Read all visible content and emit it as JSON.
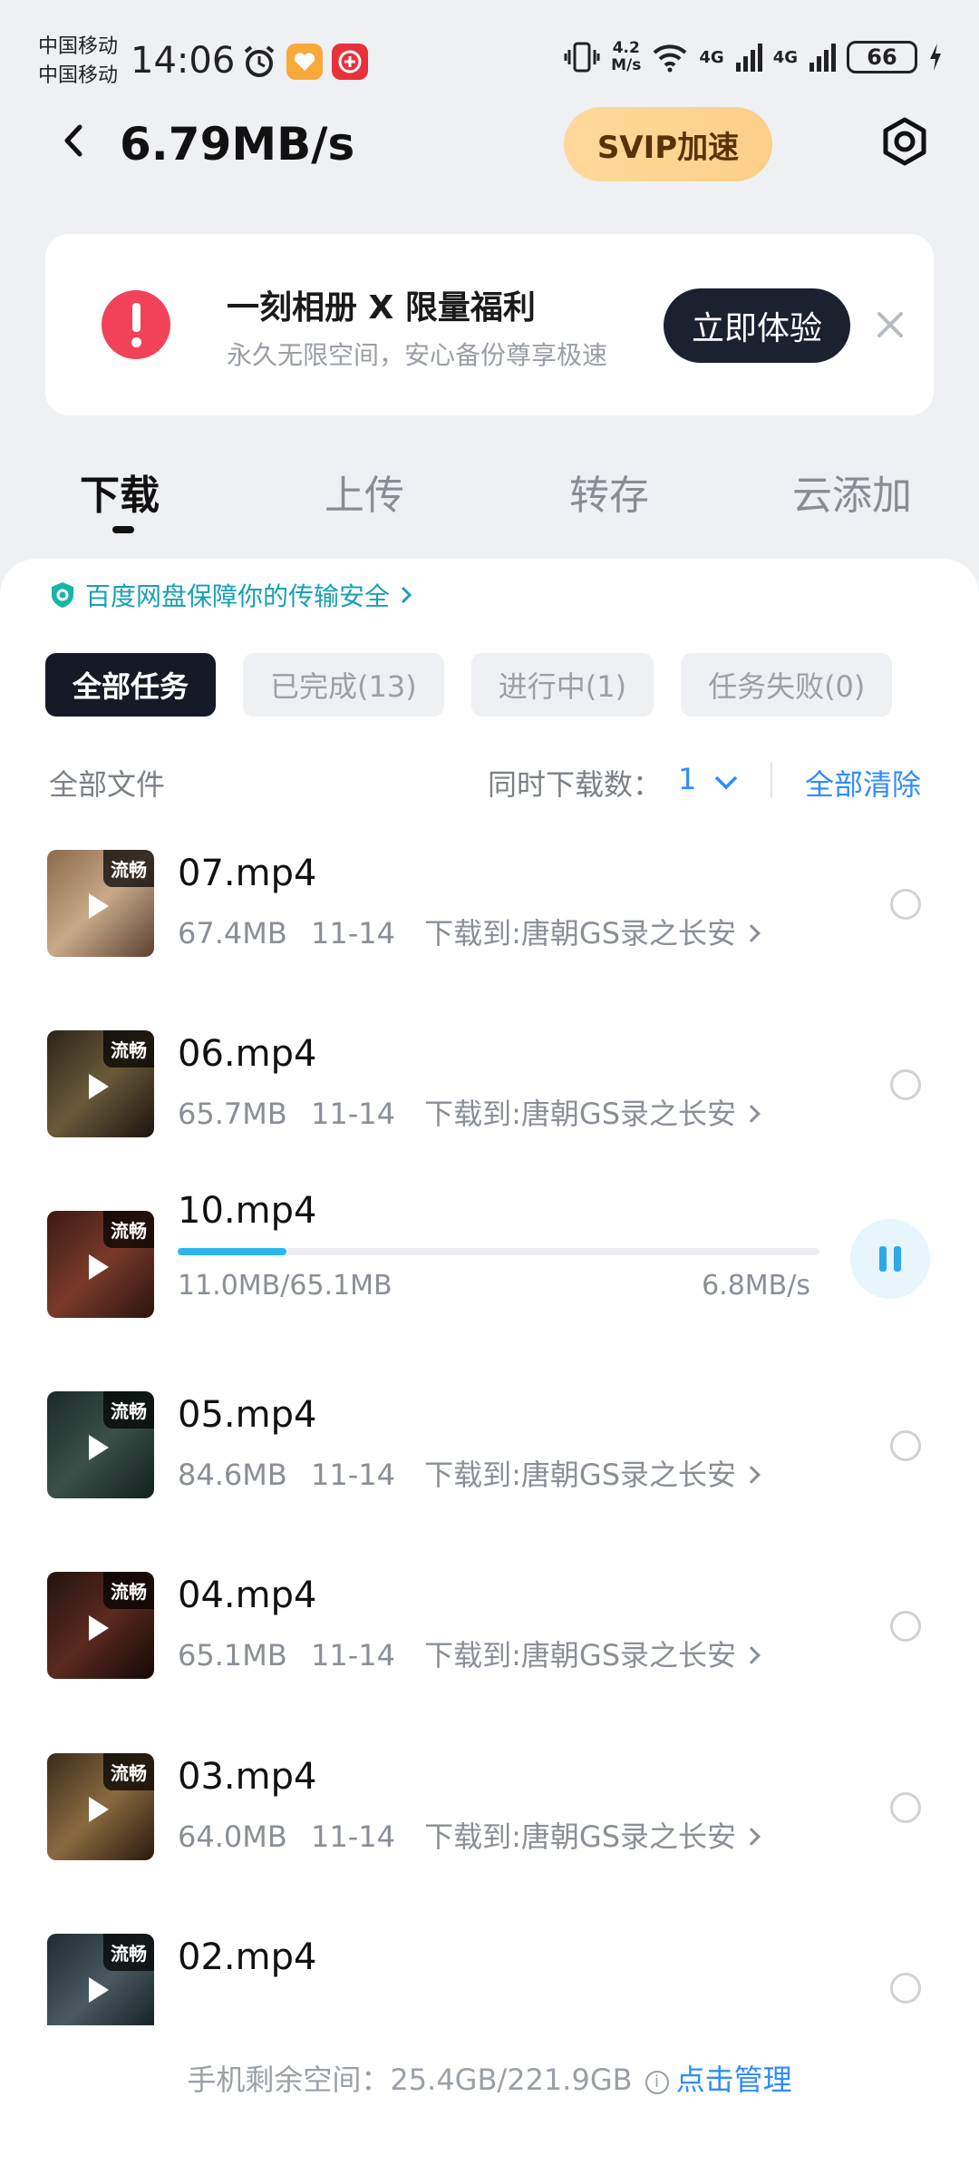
{
  "status_bar": {
    "carrier1": "中国移动",
    "carrier2": "中国移动",
    "time": "14:06",
    "net_speed_value": "4.2",
    "net_speed_unit": "M/s",
    "signal1": "4G",
    "signal2": "4G",
    "battery": "66",
    "icons": [
      "alarm-icon",
      "app-heart-icon",
      "app-1111-icon",
      "vibrate-icon",
      "wifi-icon",
      "signal-icon",
      "charging-icon"
    ]
  },
  "header": {
    "speed": "6.79MB/s",
    "svip_label": "SVIP加速"
  },
  "promo": {
    "title": "一刻相册 X 限量福利",
    "subtitle": "永久无限空间，安心备份尊享极速",
    "button": "立即体验"
  },
  "tabs": [
    {
      "label": "下载",
      "active": true
    },
    {
      "label": "上传"
    },
    {
      "label": "转存"
    },
    {
      "label": "云添加"
    }
  ],
  "safety_notice": "百度网盘保障你的传输安全",
  "filters": [
    {
      "label": "全部任务",
      "active": true
    },
    {
      "label": "已完成(13)"
    },
    {
      "label": "进行中(1)"
    },
    {
      "label": "任务失败(0)"
    }
  ],
  "list_header": {
    "all_files": "全部文件",
    "concurrent_label": "同时下载数：",
    "concurrent_value": "1",
    "clear_all": "全部清除"
  },
  "items": [
    {
      "name": "07.mp4",
      "size": "67.4MB",
      "date": "11-14",
      "dest": "下载到:唐朝GS录之长安",
      "tag": "流畅"
    },
    {
      "name": "06.mp4",
      "size": "65.7MB",
      "date": "11-14",
      "dest": "下载到:唐朝GS录之长安",
      "tag": "流畅"
    },
    {
      "name": "10.mp4",
      "progress_text": "11.0MB/65.1MB",
      "speed": "6.8MB/s",
      "progress": 0.169,
      "tag": "流畅"
    },
    {
      "name": "05.mp4",
      "size": "84.6MB",
      "date": "11-14",
      "dest": "下载到:唐朝GS录之长安",
      "tag": "流畅"
    },
    {
      "name": "04.mp4",
      "size": "65.1MB",
      "date": "11-14",
      "dest": "下载到:唐朝GS录之长安",
      "tag": "流畅"
    },
    {
      "name": "03.mp4",
      "size": "64.0MB",
      "date": "11-14",
      "dest": "下载到:唐朝GS录之长安",
      "tag": "流畅"
    },
    {
      "name": "02.mp4",
      "tag": "流畅"
    }
  ],
  "footer": {
    "storage_label": "手机剩余空间：",
    "storage_value": "25.4GB/221.9GB",
    "manage": "点击管理"
  },
  "colors": {
    "accent_blue": "#2f8cff",
    "progress": "#2cb6f0",
    "dark": "#161a26",
    "alert": "#f2425a",
    "svip": "#fbcf88"
  }
}
